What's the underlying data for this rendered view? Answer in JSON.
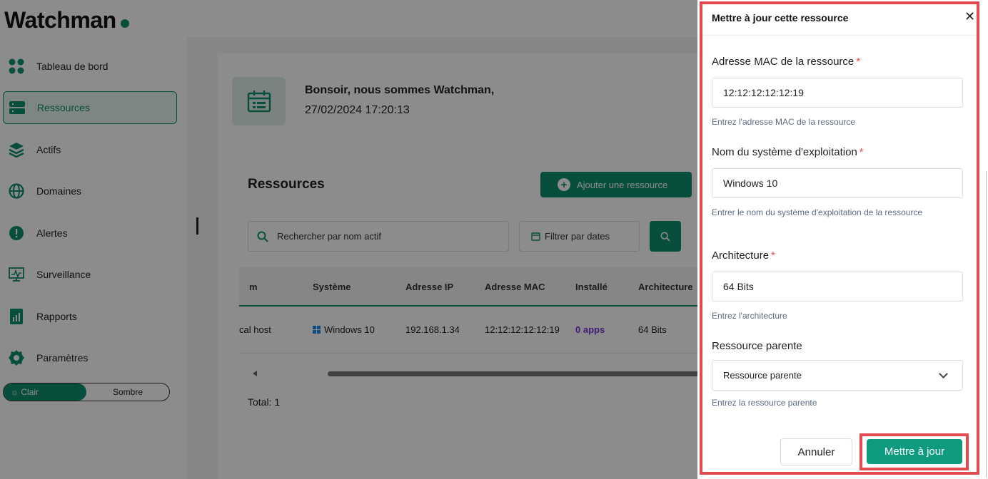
{
  "app": {
    "logo": "Watchman",
    "sidebar": {
      "items": [
        {
          "label": "Tableau de bord",
          "icon": "dashboard-icon",
          "active": false
        },
        {
          "label": "Ressources",
          "icon": "server-icon",
          "active": true
        },
        {
          "label": "Actifs",
          "icon": "layers-icon",
          "active": false
        },
        {
          "label": "Domaines",
          "icon": "globe-icon",
          "active": false
        },
        {
          "label": "Alertes",
          "icon": "alert-icon",
          "active": false
        },
        {
          "label": "Surveillance",
          "icon": "monitor-icon",
          "active": false
        },
        {
          "label": "Rapports",
          "icon": "report-icon",
          "active": false
        },
        {
          "label": "Paramètres",
          "icon": "settings-icon",
          "active": false
        }
      ],
      "theme": {
        "light": "Clair",
        "dark": "Sombre"
      }
    },
    "greeting": {
      "title": "Bonsoir, nous sommes Watchman,",
      "date": "27/02/2024 17:20:13"
    },
    "resources": {
      "title": "Ressources",
      "add_button": "Ajouter une ressource",
      "search_placeholder": "Rechercher par nom actif",
      "date_filter": "Filtrer par dates",
      "columns": [
        "m",
        "Système",
        "Adresse IP",
        "Adresse MAC",
        "Installé",
        "Architecture"
      ],
      "rows": [
        {
          "name": "cal host",
          "system": "Windows 10",
          "ip": "192.168.1.34",
          "mac": "12:12:12:12:12:19",
          "installed": "0 apps",
          "arch": "64 Bits"
        }
      ],
      "total": "Total: 1"
    }
  },
  "drawer": {
    "title": "Mettre à jour cette ressource",
    "fields": {
      "mac": {
        "label": "Adresse MAC de la ressource",
        "value": "12:12:12:12:12:19",
        "help": "Entrez l'adresse MAC de la ressource"
      },
      "os": {
        "label": "Nom du système d'exploitation",
        "value": "Windows 10",
        "help": "Entrer le nom du système d'exploitation de la ressource"
      },
      "arch": {
        "label": "Architecture",
        "value": "64 Bits",
        "help": "Entrez l'architecture"
      },
      "parent": {
        "label": "Ressource parente",
        "value": "Ressource parente",
        "help": "Entrez la ressource parente"
      }
    },
    "required_mark": "*",
    "cancel": "Annuler",
    "submit": "Mettre à jour"
  },
  "colors": {
    "accent": "#0f8f6f",
    "highlight": "#e24a4f"
  }
}
